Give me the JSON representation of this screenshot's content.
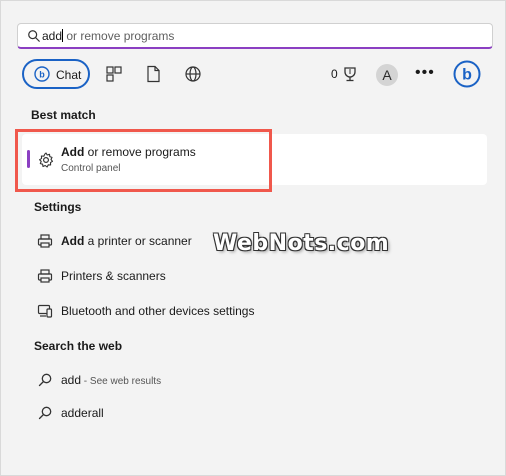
{
  "search": {
    "typed": "add",
    "suggestion": " or remove programs"
  },
  "toolbar": {
    "chat_label": "Chat",
    "tools": [
      "apps-icon",
      "document-icon",
      "globe-icon"
    ],
    "reward_count": "0",
    "avatar_letter": "A",
    "more_label": "•••"
  },
  "best_match": {
    "heading": "Best match",
    "item": {
      "title_bold": "Add",
      "title_rest": " or remove programs",
      "subtitle": "Control panel"
    }
  },
  "settings": {
    "heading": "Settings",
    "items": [
      {
        "bold": "Add",
        "rest": " a printer or scanner",
        "icon": "printer-icon"
      },
      {
        "bold": "",
        "rest": "Printers & scanners",
        "icon": "printer-icon"
      },
      {
        "bold": "",
        "rest": "Bluetooth and other devices settings",
        "icon": "devices-icon"
      }
    ]
  },
  "web": {
    "heading": "Search the web",
    "items": [
      {
        "text": "add",
        "hint": " - See web results",
        "icon": "search-icon"
      },
      {
        "text": "adderall",
        "hint": "",
        "icon": "search-icon"
      }
    ]
  },
  "watermark": "WebNots.com",
  "colors": {
    "accent": "#8b3fc2",
    "chat_border": "#1a62c5",
    "highlight": "#f0584c",
    "background": "#f3f3f3"
  }
}
